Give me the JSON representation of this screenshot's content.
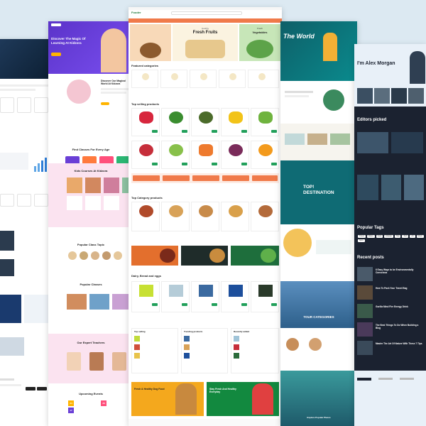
{
  "panel_kids": {
    "hero_title": "Discover The Magic Of Learning At Kidzora",
    "about_title": "Discover Our Magical World At Kidzora",
    "classes_title": "Find Classes For Every Age",
    "courses_title": "Kids Courses At Kidzora",
    "popular_title": "Popular Class Topic",
    "popular_classes": "Popular Classes",
    "teachers_title": "Our Expert Teachers",
    "events_title": "Upcoming Events",
    "event_days": [
      "24",
      "17",
      "28"
    ],
    "brand": "Kidzora"
  },
  "panel_grocery": {
    "brand": "Fooder",
    "hero": [
      {
        "small": "Healthy",
        "big": "Fresh Fruits"
      },
      {
        "small": "Fresh",
        "big": "Vegetables"
      }
    ],
    "featured_title": "Featured categories",
    "top_selling_title": "Top selling products",
    "top_category_title": "Top Category products",
    "dairy_title": "Dairy, Bread and eggs",
    "col_titles": [
      "Top selling",
      "Trending products",
      "Recently added"
    ],
    "promo": [
      "Fresh & Healthy Dog Food",
      "Stay Fresh And Healthy Everyday"
    ]
  },
  "panel_travel": {
    "hero": "The World",
    "destination": "TOP! DESTINATION",
    "categories": "TOUR CATEGORIES",
    "explore": "Explore Popular Places"
  },
  "panel_blog": {
    "hero_name": "I'm Alex Morgan",
    "editors": "Editors picked",
    "tags_title": "Popular Tags",
    "recent_title": "Recent posts",
    "recent_posts": [
      "6 Easy Ways to be Environmentally Conscious",
      "How To Pack Your Travel Bag",
      "Gorilla Mind Fire Energy Drink",
      "The Best Things To Do When Building a Blog",
      "Master The Art Of Nature With These 7 Tips"
    ],
    "tags": [
      "Travel",
      "Nature",
      "Food",
      "Lifestyle",
      "Tips",
      "Tech",
      "Art",
      "Music",
      "Sport"
    ]
  },
  "colors": {
    "background": "#dce9f2",
    "kids_purple": "#6a3fd6",
    "grocery_orange": "#f07a4a",
    "travel_teal": "#0f5b66",
    "blog_navy": "#1b2230"
  }
}
